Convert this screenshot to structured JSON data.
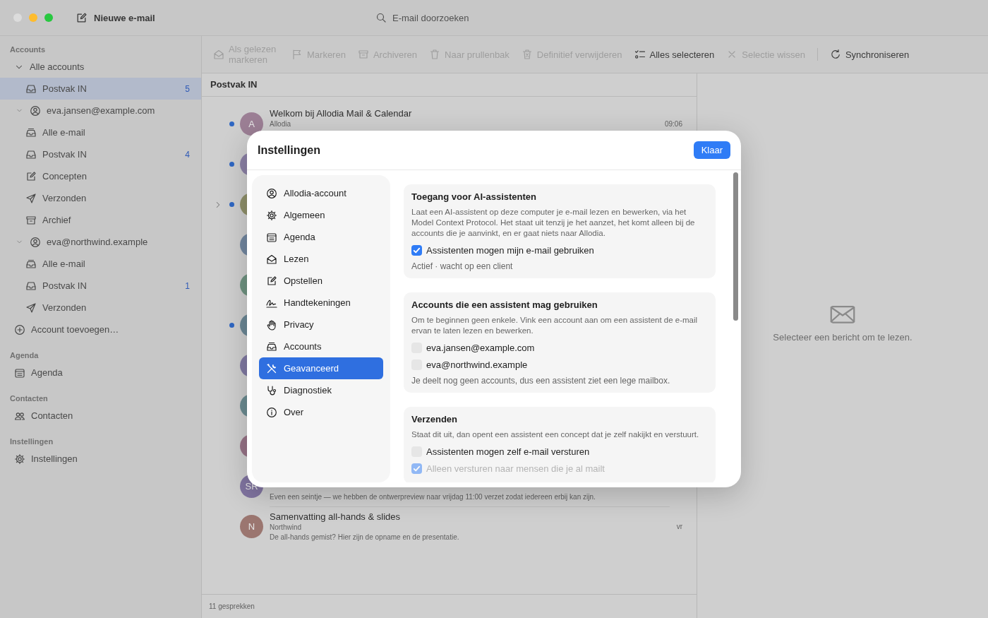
{
  "window": {
    "compose_button": "Nieuwe e-mail",
    "search": {
      "placeholder": "E-mail doorzoeken"
    }
  },
  "sidebar": {
    "sections": [
      {
        "heading": "Accounts",
        "items": [
          {
            "kind": "group",
            "label": "Alle accounts",
            "selected": false,
            "expanded": true,
            "children": [
              {
                "kind": "inbox",
                "label": "Postvak IN",
                "badge": "5",
                "selected": true
              }
            ]
          },
          {
            "kind": "account",
            "label": "eva.jansen@example.com",
            "selected": false,
            "expanded": true,
            "children": [
              {
                "kind": "all_mail",
                "label": "Alle e-mail",
                "selected": false
              },
              {
                "kind": "inbox",
                "label": "Postvak IN",
                "badge": "4",
                "selected": false
              },
              {
                "kind": "drafts",
                "label": "Concepten",
                "selected": false
              },
              {
                "kind": "sent",
                "label": "Verzonden",
                "selected": false
              },
              {
                "kind": "archive",
                "label": "Archief",
                "selected": false
              }
            ]
          },
          {
            "kind": "account",
            "label": "eva@northwind.example",
            "selected": false,
            "expanded": true,
            "children": [
              {
                "kind": "all_mail",
                "label": "Alle e-mail",
                "selected": false
              },
              {
                "kind": "inbox",
                "label": "Postvak IN",
                "badge": "1",
                "selected": false
              },
              {
                "kind": "sent",
                "label": "Verzonden",
                "selected": false
              }
            ]
          },
          {
            "kind": "add",
            "label": "Account toevoegen…",
            "selected": false
          }
        ]
      },
      {
        "heading": "Agenda",
        "items": [
          {
            "kind": "calendar",
            "label": "Agenda",
            "selected": false
          }
        ]
      },
      {
        "heading": "Contacten",
        "items": [
          {
            "kind": "contacts",
            "label": "Contacten",
            "selected": false
          }
        ]
      },
      {
        "heading": "Instellingen",
        "items": [
          {
            "kind": "settings",
            "label": "Instellingen",
            "selected": false
          }
        ]
      }
    ]
  },
  "toolbar": {
    "groups": [
      {
        "buttons": [
          {
            "label": "Als gelezen markeren",
            "disabled": true
          },
          {
            "label": "Markeren",
            "disabled": true
          },
          {
            "label": "Archiveren",
            "disabled": true
          },
          {
            "label": "Naar prullenbak",
            "disabled": true
          },
          {
            "label": "Definitief verwijderen",
            "disabled": true
          },
          {
            "label": "Alles selecteren",
            "disabled": false
          },
          {
            "label": "Selectie wissen",
            "disabled": true
          }
        ]
      },
      {
        "buttons": [
          {
            "label": "Synchroniseren",
            "disabled": false
          }
        ]
      }
    ]
  },
  "mailbox": {
    "title": "Postvak IN",
    "messages": [
      {
        "unread": true,
        "initials": "A",
        "color": "#9c7f95",
        "subject": "Welkom bij Allodia Mail & Calendar",
        "sender": "Allodia",
        "time": "09:06"
      },
      {
        "unread": true,
        "color": "#8b80a5"
      },
      {
        "unread": true,
        "color": "#8f906a",
        "expanded": false
      },
      {
        "unread": false,
        "color": "#7287a0"
      },
      {
        "unread": false,
        "color": "#6f9381"
      },
      {
        "unread": true,
        "color": "#6b8795"
      },
      {
        "unread": false,
        "color": "#8079a2"
      },
      {
        "unread": false,
        "color": "#6b8b91"
      },
      {
        "unread": false,
        "color": "#977387"
      },
      {
        "unread": false,
        "initials": "SR",
        "color": "#8074a0",
        "preview": "Even een seintje — we hebben de ontwerpreview naar vrijdag 11:00 verzet zodat iedereen erbij kan zijn."
      },
      {
        "unread": false,
        "initials": "N",
        "color": "#9b7670",
        "subject": "Samenvatting all-hands & slides",
        "sender": "Northwind",
        "time": "vr",
        "preview": "De all-hands gemist? Hier zijn de opname en de presentatie."
      }
    ],
    "footer": "11 gesprekken"
  },
  "reading_pane": {
    "empty_text": "Selecteer een bericht om te lezen."
  },
  "settings_dialog": {
    "title": "Instellingen",
    "done_button": "Klaar",
    "nav": [
      {
        "label": "Allodia-account",
        "selected": false
      },
      {
        "label": "Algemeen",
        "selected": false
      },
      {
        "label": "Agenda",
        "selected": false
      },
      {
        "label": "Lezen",
        "selected": false
      },
      {
        "label": "Opstellen",
        "selected": false
      },
      {
        "label": "Handtekeningen",
        "selected": false
      },
      {
        "label": "Privacy",
        "selected": false
      },
      {
        "label": "Accounts",
        "selected": false
      },
      {
        "label": "Geavanceerd",
        "selected": true
      },
      {
        "label": "Diagnostiek",
        "selected": false
      },
      {
        "label": "Over",
        "selected": false
      }
    ],
    "sections": [
      {
        "title": "Toegang voor AI-assistenten",
        "description": "Laat een AI-assistent op deze computer je e-mail lezen en bewerken, via het Model Context Protocol. Het staat uit tenzij je het aanzet, het komt alleen bij de accounts die je aanvinkt, en er gaat niets naar Allodia.",
        "options": [
          {
            "label": "Assistenten mogen mijn e-mail gebruiken",
            "checked": true,
            "disabled": false
          }
        ],
        "note": "Actief · wacht op een client"
      },
      {
        "title": "Accounts die een assistent mag gebruiken",
        "description": "Om te beginnen geen enkele. Vink een account aan om een assistent de e-mail ervan te laten lezen en bewerken.",
        "options": [
          {
            "label": "eva.jansen@example.com",
            "checked": false,
            "disabled": false
          },
          {
            "label": "eva@northwind.example",
            "checked": false,
            "disabled": false
          }
        ],
        "note": "Je deelt nog geen accounts, dus een assistent ziet een lege mailbox."
      },
      {
        "title": "Verzenden",
        "description": "Staat dit uit, dan opent een assistent een concept dat je zelf nakijkt en verstuurt.",
        "options": [
          {
            "label": "Assistenten mogen zelf e-mail versturen",
            "checked": false,
            "disabled": false
          },
          {
            "label": "Alleen versturen naar mensen die je al mailt",
            "checked": true,
            "disabled": true
          }
        ]
      }
    ]
  }
}
